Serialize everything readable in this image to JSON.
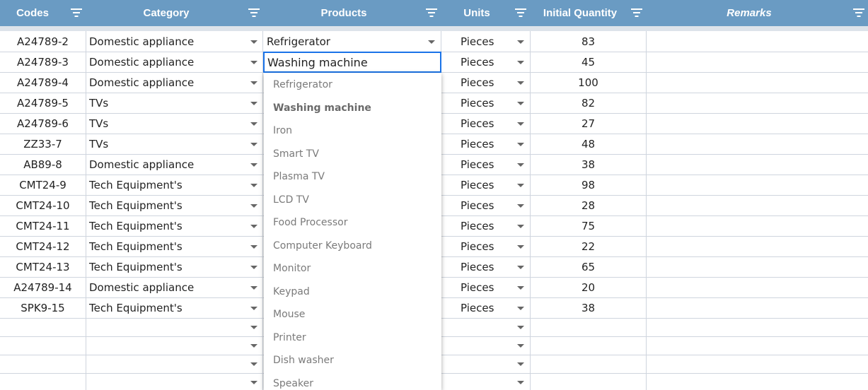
{
  "header": {
    "codes": "Codes",
    "category": "Category",
    "products": "Products",
    "units": "Units",
    "initial_quantity": "Initial Quantity",
    "remarks": "Remarks"
  },
  "rows": [
    {
      "code": "A24789-2",
      "category": "Domestic appliance",
      "product": "Refrigerator",
      "unit": "Pieces",
      "qty": "83"
    },
    {
      "code": "A24789-3",
      "category": "Domestic appliance",
      "product": "Washing machine",
      "unit": "Pieces",
      "qty": "45"
    },
    {
      "code": "A24789-4",
      "category": "Domestic appliance",
      "product": "",
      "unit": "Pieces",
      "qty": "100"
    },
    {
      "code": "A24789-5",
      "category": "TVs",
      "product": "",
      "unit": "Pieces",
      "qty": "82"
    },
    {
      "code": "A24789-6",
      "category": "TVs",
      "product": "",
      "unit": "Pieces",
      "qty": "27"
    },
    {
      "code": "ZZ33-7",
      "category": "TVs",
      "product": "",
      "unit": "Pieces",
      "qty": "48"
    },
    {
      "code": "AB89-8",
      "category": "Domestic appliance",
      "product": "",
      "unit": "Pieces",
      "qty": "38"
    },
    {
      "code": "CMT24-9",
      "category": "Tech Equipment's",
      "product": "",
      "unit": "Pieces",
      "qty": "98"
    },
    {
      "code": "CMT24-10",
      "category": "Tech Equipment's",
      "product": "",
      "unit": "Pieces",
      "qty": "28"
    },
    {
      "code": "CMT24-11",
      "category": "Tech Equipment's",
      "product": "",
      "unit": "Pieces",
      "qty": "75"
    },
    {
      "code": "CMT24-12",
      "category": "Tech Equipment's",
      "product": "",
      "unit": "Pieces",
      "qty": "22"
    },
    {
      "code": "CMT24-13",
      "category": "Tech Equipment's",
      "product": "",
      "unit": "Pieces",
      "qty": "65"
    },
    {
      "code": "A24789-14",
      "category": "Domestic appliance",
      "product": "",
      "unit": "Pieces",
      "qty": "20"
    },
    {
      "code": "SPK9-15",
      "category": "Tech Equipment's",
      "product": "",
      "unit": "Pieces",
      "qty": "38"
    }
  ],
  "empty_rows": 4,
  "editing_value": "Washing machine",
  "dropdown": {
    "selected": "Washing machine",
    "options": [
      "Refrigerator",
      "Washing machine",
      "Iron",
      "Smart TV",
      "Plasma TV",
      "LCD TV",
      "Food Processor",
      "Computer Keyboard",
      "Monitor",
      "Keypad",
      "Mouse",
      "Printer",
      "Dish washer",
      "Speaker"
    ]
  },
  "colors": {
    "header_bg": "#6a9bc3",
    "editing_border": "#1a73e8"
  }
}
